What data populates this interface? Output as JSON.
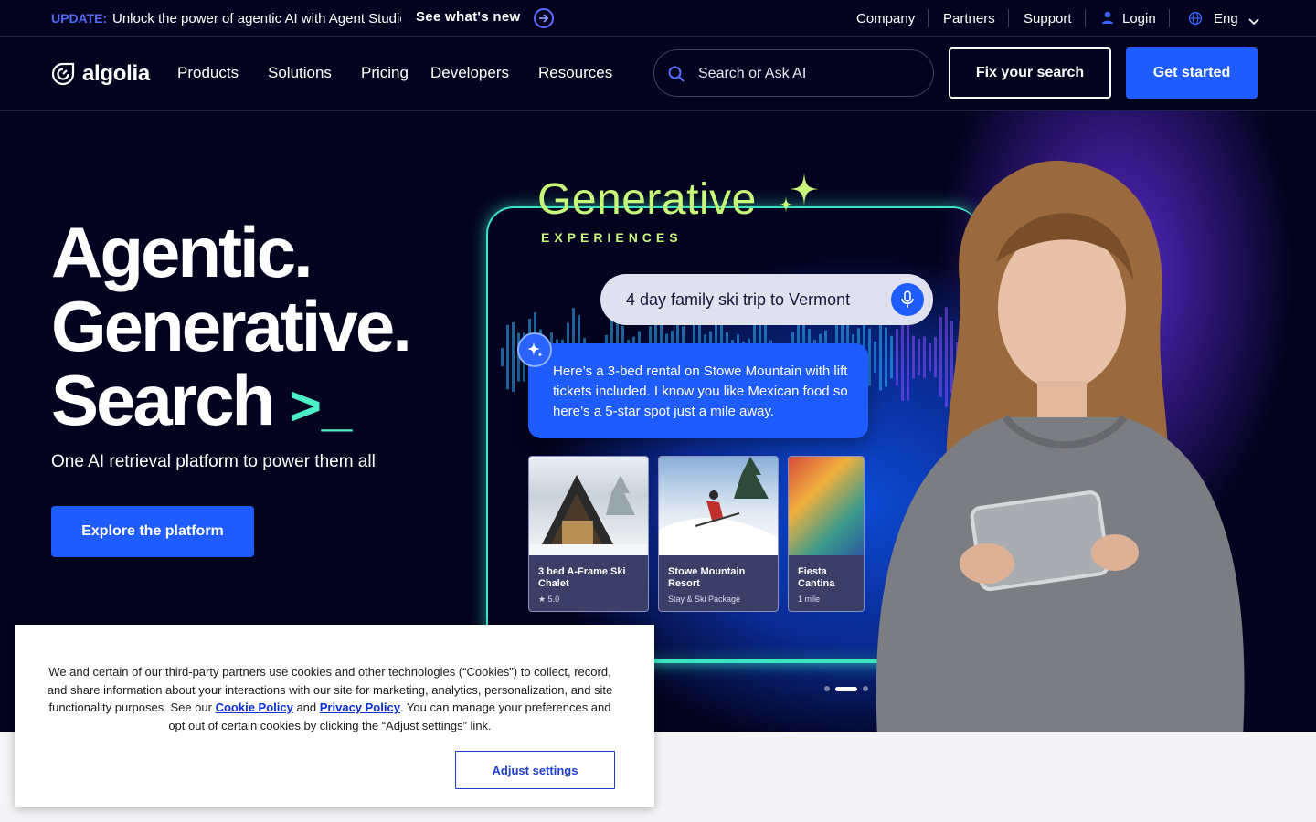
{
  "topbar": {
    "update_label": "UPDATE:",
    "update_text": "Unlock the power of agentic AI with Agent Studio",
    "see_new": "See what's new",
    "links": [
      "Company",
      "Partners",
      "Support"
    ],
    "login": "Login",
    "language": "Eng"
  },
  "nav": {
    "brand": "algolia",
    "links": [
      "Products",
      "Solutions",
      "Pricing",
      "Developers",
      "Resources"
    ],
    "search_placeholder": "Search or Ask AI",
    "fix_label": "Fix your search",
    "start_label": "Get started"
  },
  "hero": {
    "line1": "Agentic.",
    "line2": "Generative.",
    "line3": "Search",
    "cursor": ">_",
    "subtitle": "One AI retrieval platform to power them all",
    "cta": "Explore the platform"
  },
  "visual": {
    "title": "Generative",
    "subtitle": "EXPERIENCES",
    "query": "4 day family ski trip to Vermont",
    "answer": "Here’s a 3-bed rental on Stowe Mountain with lift tickets included. I know you like Mexican food so here’s a 5-star spot just a mile away.",
    "cards": [
      {
        "title": "3 bed A-Frame Ski Chalet",
        "meta": "★ 5.0"
      },
      {
        "title": "Stowe Mountain Resort",
        "meta": "Stay & Ski Package"
      },
      {
        "title": "Fiesta Cantina",
        "meta": "1 mile"
      }
    ],
    "carousel_active": 2,
    "carousel_total": 3
  },
  "cookie": {
    "text_1": "We and certain of our third-party partners use cookies and other technologies (“Cookies”) to collect, record, and share information about your interactions with our site for marketing, analytics, personalization, and site functionality purposes. See our ",
    "cookie_policy": "Cookie Policy",
    "text_2": " and ",
    "privacy_policy": "Privacy Policy",
    "text_3": ". You can manage your preferences and opt out of certain cookies by clicking the “Adjust settings” link.",
    "adjust": "Adjust settings"
  },
  "colors": {
    "background": "#03031f",
    "accent": "#1f5cff",
    "update_label": "#5468ff",
    "glow_green": "#3be5c4",
    "title_green": "#c8f87a"
  }
}
